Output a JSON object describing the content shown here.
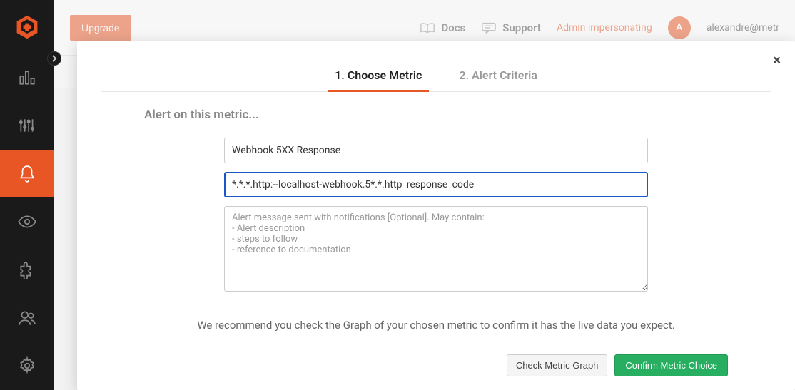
{
  "header": {
    "upgrade": "Upgrade",
    "docs": "Docs",
    "support": "Support",
    "admin": "Admin impersonating",
    "avatar_initial": "A",
    "user_email": "alexandre@metr"
  },
  "modal": {
    "tabs": {
      "choose_metric": "1. Choose Metric",
      "alert_criteria": "2. Alert Criteria"
    },
    "section_label": "Alert on this metric...",
    "name_value": "Webhook 5XX Response",
    "metric_value": "*.*.*.http:--localhost-webhook.5*.*.http_response_code",
    "message_placeholder": "Alert message sent with notifications [Optional]. May contain:\n- Alert description\n- steps to follow\n- reference to documentation",
    "recommend": "We recommend you check the Graph of your chosen metric to confirm it has the live data you expect.",
    "check_graph": "Check Metric Graph",
    "confirm": "Confirm Metric Choice",
    "close": "×"
  }
}
